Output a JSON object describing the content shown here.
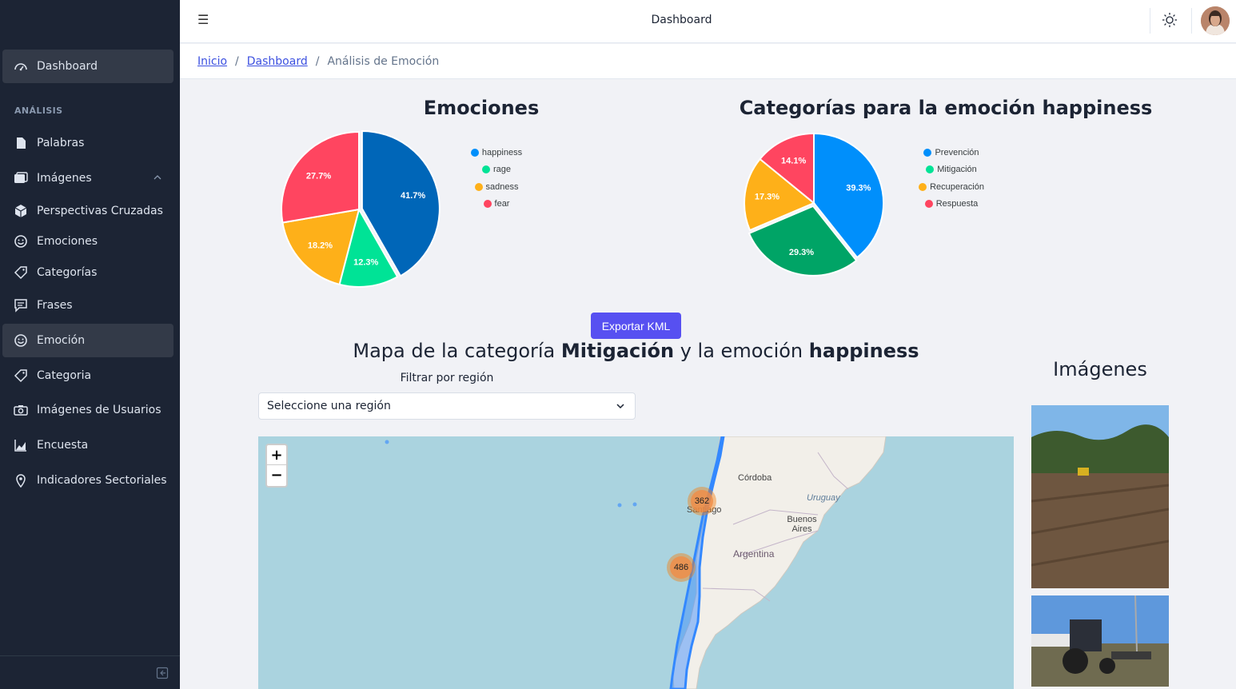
{
  "header": {
    "title": "Dashboard"
  },
  "breadcrumb": {
    "home": "Inicio",
    "dashboard": "Dashboard",
    "current": "Análisis de Emoción"
  },
  "sidebar": {
    "top_item": "Dashboard",
    "section_title": "ANÁLISIS",
    "items": [
      {
        "label": "Palabras",
        "icon": "document-icon"
      },
      {
        "label": "Imágenes",
        "icon": "images-icon"
      },
      {
        "label": "Perspectivas Cruzadas",
        "icon": "cube-icon"
      },
      {
        "label": "Emociones",
        "icon": "smile-icon"
      },
      {
        "label": "Categorías",
        "icon": "tag-icon"
      },
      {
        "label": "Frases",
        "icon": "chat-icon"
      },
      {
        "label": "Emoción",
        "icon": "smile-icon"
      },
      {
        "label": "Categoria",
        "icon": "tag-icon"
      },
      {
        "label": "Imágenes de Usuarios",
        "icon": "camera-icon"
      },
      {
        "label": "Encuesta",
        "icon": "area-chart-icon"
      },
      {
        "label": "Indicadores Sectoriales",
        "icon": "map-pin-icon"
      }
    ]
  },
  "chart_data": [
    {
      "type": "pie",
      "title": "Emociones",
      "categories": [
        "happiness",
        "rage",
        "sadness",
        "fear"
      ],
      "values": [
        41.7,
        12.3,
        18.2,
        27.7
      ],
      "labels": [
        "41.7%",
        "12.3%",
        "18.2%",
        "27.7%"
      ],
      "colors": [
        "#008ffb",
        "#00e396",
        "#feb019",
        "#ff4560"
      ],
      "legend": "right"
    },
    {
      "type": "pie",
      "title": "Categorías para la emoción happiness",
      "categories": [
        "Prevención",
        "Mitigación",
        "Recuperación",
        "Respuesta"
      ],
      "values": [
        39.3,
        29.3,
        17.3,
        14.1
      ],
      "labels": [
        "39.3%",
        "29.3%",
        "17.3%",
        "14.1%"
      ],
      "colors": [
        "#008ffb",
        "#00e396",
        "#feb019",
        "#ff4560"
      ],
      "legend": "right"
    }
  ],
  "export_button": "Exportar KML",
  "map_section": {
    "title_prefix": "Mapa de la categoría ",
    "category": "Mitigación",
    "title_middle": " y la emoción ",
    "emotion": "happiness",
    "filter_label": "Filtrar por región",
    "select_value": "Seleccione una región",
    "zoom_in": "+",
    "zoom_out": "−",
    "clusters": [
      "362",
      "486"
    ],
    "places": [
      "Córdoba",
      "Uruguay",
      "Buenos Aires",
      "Argentina",
      "Santiago"
    ]
  },
  "images_section": {
    "title": "Imágenes"
  }
}
